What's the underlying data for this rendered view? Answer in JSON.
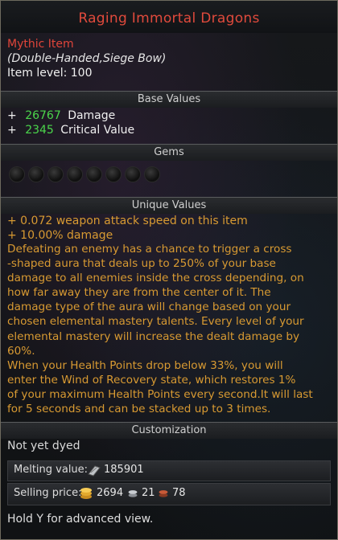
{
  "item": {
    "name": "Raging Immortal Dragons",
    "rarity": "Mythic Item",
    "type": "(Double-Handed,Siege Bow)",
    "level": "Item level: 100"
  },
  "sections": {
    "base_values": "Base Values",
    "gems": "Gems",
    "unique_values": "Unique Values",
    "customization": "Customization"
  },
  "base_values": [
    {
      "prefix": "+",
      "value": "26767",
      "label": "Damage"
    },
    {
      "prefix": "+",
      "value": "2345",
      "label": "Critical Value"
    }
  ],
  "gems": {
    "empty_slots": 8
  },
  "unique_values": [
    "+ 0.072 weapon attack speed on this item",
    "+ 10.00% damage"
  ],
  "description": "Defeating an enemy has a chance to trigger a cross\n-shaped aura that deals up to 250% of your base\ndamage to all enemies inside the cross depending, on\nhow far away they are from the center of it. The\ndamage type of the aura will change based on your\nchosen elemental mastery talents. Every level of your\nelemental mastery will increase the dealt damage by\n60%.\nWhen your Health Points drop below 33%, you will\nenter the Wind of Recovery state, which restores 1%\nof your maximum Health Points every second.It will last\nfor 5 seconds and can be stacked up to 3 times.",
  "customization": {
    "dye": "Not yet dyed"
  },
  "melting": {
    "label": "Melting value:",
    "value": "185901"
  },
  "selling": {
    "label": "Selling price:",
    "gold": "2694",
    "silver": "21",
    "copper": "78"
  },
  "hint": "Hold Y for advanced view.",
  "colors": {
    "title": "#e04a3c",
    "rarity": "#e0453a",
    "stat_value": "#4bd64b",
    "unique": "#d89a32"
  }
}
